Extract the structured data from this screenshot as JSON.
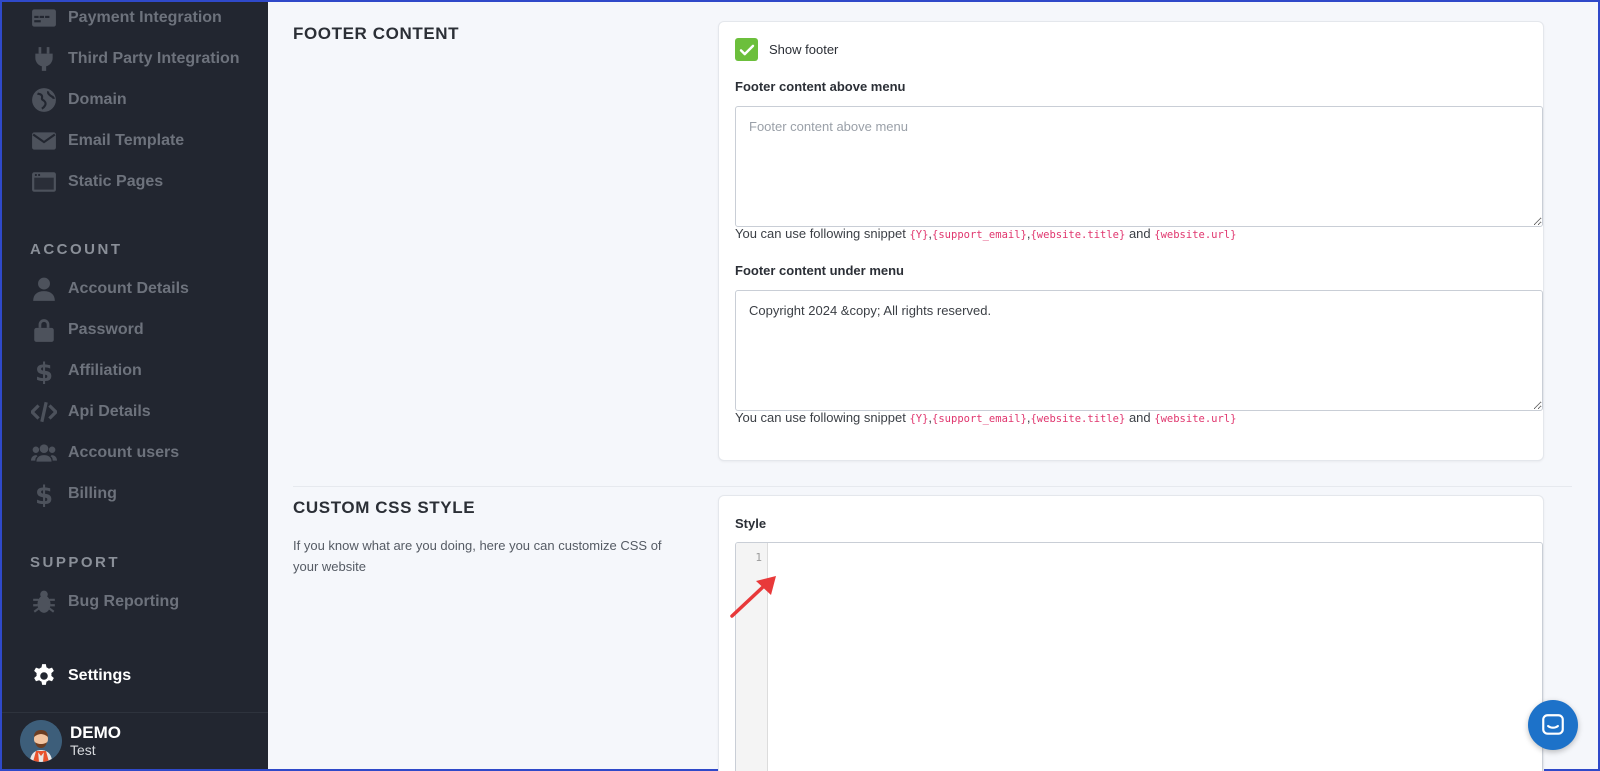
{
  "sidebar": {
    "items_top": [
      {
        "label": "Payment Integration",
        "icon": "credit-card-icon"
      },
      {
        "label": "Third Party Integration",
        "icon": "plug-icon"
      },
      {
        "label": "Domain",
        "icon": "globe-icon"
      },
      {
        "label": "Email Template",
        "icon": "envelope-icon"
      },
      {
        "label": "Static Pages",
        "icon": "window-icon"
      }
    ],
    "account_title": "ACCOUNT",
    "account_items": [
      {
        "label": "Account Details",
        "icon": "user-icon"
      },
      {
        "label": "Password",
        "icon": "lock-icon"
      },
      {
        "label": "Affiliation",
        "icon": "dollar-icon"
      },
      {
        "label": "Api Details",
        "icon": "code-icon"
      },
      {
        "label": "Account users",
        "icon": "users-icon"
      },
      {
        "label": "Billing",
        "icon": "dollar-icon"
      }
    ],
    "support_title": "SUPPORT",
    "support_items": [
      {
        "label": "Bug Reporting",
        "icon": "bug-icon"
      }
    ],
    "settings_label": "Settings",
    "user": {
      "name": "DEMO",
      "sub": "Test"
    }
  },
  "footer_section": {
    "title": "FOOTER CONTENT",
    "show_footer_label": "Show footer",
    "show_footer_checked": true,
    "above_label": "Footer content above menu",
    "above_placeholder": "Footer content above menu",
    "above_value": "",
    "under_label": "Footer content under menu",
    "under_value": "Copyright 2024 &copy; All rights reserved.",
    "hint_prefix": "You can use following snippet",
    "snippet_y": "{Y}",
    "snippet_email": "{support_email}",
    "snippet_title": "{website.title}",
    "hint_and": "and",
    "snippet_url": "{website.url}"
  },
  "css_section": {
    "title": "CUSTOM CSS STYLE",
    "description": "If you know what are you doing, here you can customize CSS of your website",
    "style_label": "Style",
    "line_number": "1"
  },
  "colors": {
    "sidebar_bg": "#222630",
    "checkbox_green": "#6cbf3c",
    "snippet_pink": "#e0366e",
    "chat_blue": "#1d72c9"
  }
}
